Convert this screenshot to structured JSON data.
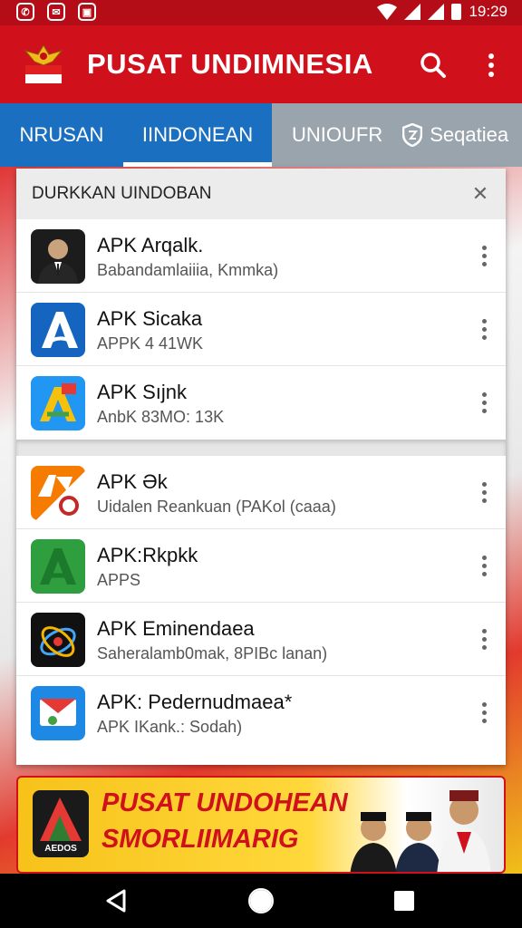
{
  "status_bar": {
    "time": "19:29",
    "icons": [
      "whatsapp-icon",
      "gmail-icon",
      "photo-icon"
    ]
  },
  "app": {
    "title": "PUSAT UNDIMNESIA"
  },
  "tabs": [
    {
      "label": "NRUSAN"
    },
    {
      "label": "IINDONEAN"
    },
    {
      "label": "UNIOUFR"
    },
    {
      "label": "Seqatiea"
    }
  ],
  "panel": {
    "title": "DURKKAN UINDOBAN",
    "groups": [
      {
        "items": [
          {
            "name": "APK Arqalk.",
            "subtitle": "Babandamlaiiia, Kmmka)",
            "icon": "portrait-icon"
          },
          {
            "name": "APK Sicaka",
            "subtitle": "APPK 4 41WK",
            "icon": "letter-a-blue-icon"
          },
          {
            "name": "APK Sıjnk",
            "subtitle": "AnbK 83MO: 13K",
            "icon": "colorful-a-icon"
          }
        ]
      },
      {
        "items": [
          {
            "name": "APK Ək",
            "subtitle": "Uidalen Reankuan (PAKol (caaa)",
            "icon": "ar-orange-icon"
          },
          {
            "name": "APK:Rkpkk",
            "subtitle": "APPS",
            "icon": "green-a-icon"
          },
          {
            "name": "APK Eminendaea",
            "subtitle": "Saheralamb0mak,  8PIBc lanan)",
            "icon": "orbit-icon"
          },
          {
            "name": "APK: Pedernudmaea*",
            "subtitle": "APK IKank.: Sodah)",
            "icon": "blue-map-icon"
          }
        ]
      }
    ]
  },
  "banner": {
    "line1": "PUSAT UNDOHEAN",
    "line2": "SMORLIIMARIG",
    "logo_text": "AEDOS"
  },
  "colors": {
    "primary_red": "#d0111c",
    "tab_blue": "#1b6fc1",
    "tab_gray": "#9aa4ad"
  }
}
